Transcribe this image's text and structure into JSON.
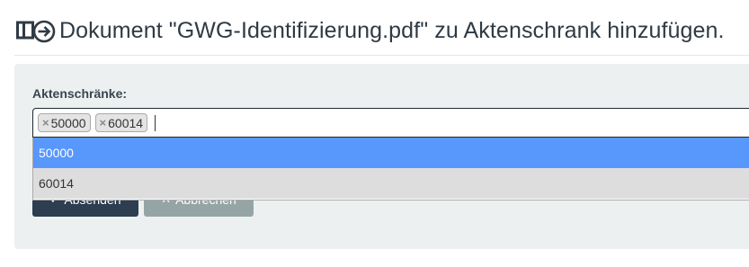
{
  "header": {
    "title": "Dokument \"GWG-Identifizierung.pdf\" zu Aktenschrank hinzufügen.",
    "icon": "file-cabinet-add-icon"
  },
  "form": {
    "label": "Aktenschränke:",
    "selected_tags": [
      {
        "remove_glyph": "×",
        "value": "50000"
      },
      {
        "remove_glyph": "×",
        "value": "60014"
      }
    ],
    "dropdown_options": [
      {
        "label": "50000",
        "highlighted": true
      },
      {
        "label": "60014",
        "highlighted": false
      }
    ],
    "submit_label": "Absenden",
    "submit_icon": "✓",
    "cancel_label": "Abbrechen",
    "cancel_icon": "✕"
  },
  "colors": {
    "title_text": "#2f3a44",
    "panel_bg": "#edf0f1",
    "highlight": "#5897fb",
    "submit_bg": "#2c3e50",
    "cancel_bg": "#95a5a6"
  }
}
